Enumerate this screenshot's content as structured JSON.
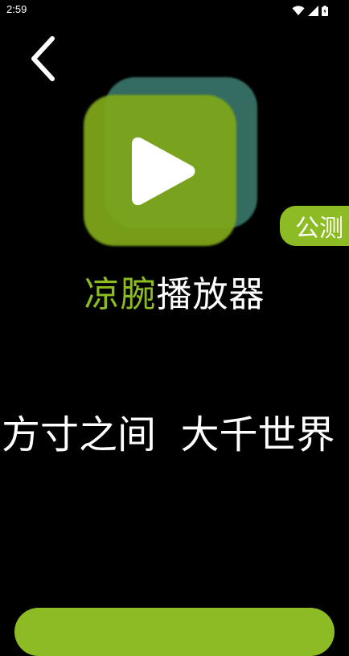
{
  "status_bar": {
    "time": "2:59",
    "icons": [
      "wifi-icon",
      "signal-icon",
      "battery-icon"
    ]
  },
  "header": {
    "back_icon": "chevron-left-icon"
  },
  "logo": {
    "icon": "play-icon",
    "colors": {
      "front": "#7fa81a",
      "back": "#3e7f72"
    }
  },
  "badge": {
    "label": "公测"
  },
  "title": {
    "accent": "凉腕",
    "rest": "播放器"
  },
  "slogan": {
    "text": "方寸之间  大千世界"
  },
  "colors": {
    "accent": "#8dbb23",
    "background": "#000000",
    "text": "#ffffff"
  }
}
